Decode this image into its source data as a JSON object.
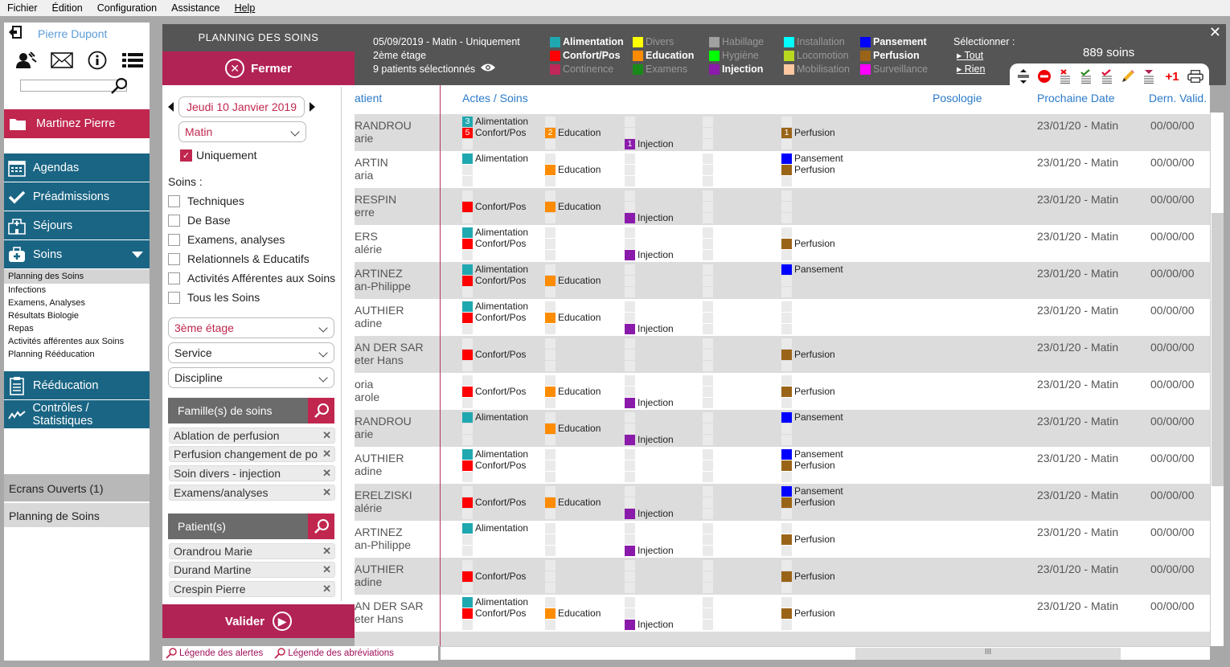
{
  "menubar": [
    "Fichier",
    "Édition",
    "Configuration",
    "Assistance",
    "Help"
  ],
  "user": {
    "name": "Pierre Dupont",
    "search_placeholder": ""
  },
  "patient_button": "Martinez Pierre",
  "nav": {
    "items": [
      "Agendas",
      "Préadmissions",
      "Séjours",
      "Soins"
    ],
    "soins_subitems": [
      "Planning des Soins",
      "Infections",
      "Examens, Analyses",
      "Résultats Biologie",
      "Repas",
      "Activités afférentes aux Soins",
      "Planning  Rééducation"
    ],
    "items2": [
      "Rééducation",
      "Contrôles / Statistiques"
    ],
    "open_screens": "Ecrans Ouverts (1)",
    "open_screen_item": "Planning de Soins"
  },
  "filter": {
    "title": "PLANNING DES SOINS",
    "close": "Fermer",
    "date": "Jeudi 10 Janvier 2019",
    "period": "Matin",
    "only_label": "Uniquement",
    "only_checked": true,
    "soins_label": "Soins :",
    "soins_options": [
      "Techniques",
      "De Base",
      "Examens, analyses",
      "Relationnels & Educatifs",
      "Activités Afférentes aux Soins",
      "Tous les Soins"
    ],
    "floor": "3ème étage",
    "service": "Service",
    "discipline": "Discipline",
    "families_head": "Famille(s) de soins",
    "families": [
      "Ablation de perfusion",
      "Perfusion changement de po",
      "Soin divers - injection",
      "Examens/analyses"
    ],
    "patients_head": "Patient(s)",
    "patients": [
      "Orandrou Marie",
      "Durand Martine",
      "Crespin Pierre"
    ],
    "validate": "Valider"
  },
  "footer_links": [
    "Légende des alertes",
    "Légende des abréviations"
  ],
  "header": {
    "line1": "05/09/2019 - Matin - Uniquement",
    "line2": "2ème étage",
    "line3": "9 patients sélectionnés",
    "select_label": "Sélectionner :",
    "select_all": "Tout",
    "select_none": "Rien",
    "count": "889 soins"
  },
  "legend": [
    [
      {
        "label": "Alimentation",
        "color": "#20a8b0",
        "on": true
      },
      {
        "label": "Confort/Pos",
        "color": "#ff0000",
        "on": true
      },
      {
        "label": "Continence",
        "color": "#c0285a",
        "on": false
      }
    ],
    [
      {
        "label": "Divers",
        "color": "#ffff00",
        "on": false
      },
      {
        "label": "Education",
        "color": "#ff8c00",
        "on": true
      },
      {
        "label": "Examens",
        "color": "#1a8a1a",
        "on": false
      }
    ],
    [
      {
        "label": "Habillage",
        "color": "#a0a0a0",
        "on": false
      },
      {
        "label": "Hygiène",
        "color": "#00ff00",
        "on": false
      },
      {
        "label": "Injection",
        "color": "#8a1aaa",
        "on": true
      }
    ],
    [
      {
        "label": "Installation",
        "color": "#00ffff",
        "on": false
      },
      {
        "label": "Locomotion",
        "color": "#b8d820",
        "on": false
      },
      {
        "label": "Mobilisation",
        "color": "#ffc8a0",
        "on": false
      }
    ],
    [
      {
        "label": "Pansement",
        "color": "#0000ff",
        "on": true
      },
      {
        "label": "Perfusion",
        "color": "#9a6418",
        "on": true
      },
      {
        "label": "Surveillance",
        "color": "#ff00ff",
        "on": false
      }
    ]
  ],
  "toolbar": [
    "expand-collapse",
    "stop",
    "unvalidate",
    "validate-green",
    "validate-red",
    "edit",
    "filter-down",
    "+1",
    "print"
  ],
  "columns": {
    "patient": "atient",
    "acts": "Actes / Soins",
    "posology": "Posologie",
    "next_date": "Prochaine Date",
    "last_valid": "Dern. Valid."
  },
  "rows": [
    {
      "name1": "RANDROU",
      "name2": "arie",
      "alim": "3",
      "conf": "5",
      "edu": "2",
      "inj": "1",
      "pan": null,
      "perf": "1",
      "next": "23/01/20 - Matin",
      "last": "00/00/00"
    },
    {
      "name1": "ARTIN",
      "name2": "aria",
      "alim": "",
      "conf": null,
      "edu": "",
      "inj": null,
      "pan": "",
      "perf": "",
      "next": "23/01/20 - Matin",
      "last": "00/00/00"
    },
    {
      "name1": "RESPIN",
      "name2": "erre",
      "alim": null,
      "conf": "",
      "edu": "",
      "inj": "",
      "pan": null,
      "perf": null,
      "next": "23/01/20 - Matin",
      "last": "00/00/00"
    },
    {
      "name1": "ERS",
      "name2": "alérie",
      "alim": "",
      "conf": "",
      "edu": null,
      "inj": "",
      "pan": null,
      "perf": "",
      "next": "23/01/20 - Matin",
      "last": "00/00/00"
    },
    {
      "name1": "ARTINEZ",
      "name2": "an-Philippe",
      "alim": "",
      "conf": "",
      "edu": "",
      "inj": null,
      "pan": "",
      "perf": null,
      "next": "23/01/20 - Matin",
      "last": "00/00/00"
    },
    {
      "name1": "AUTHIER",
      "name2": "adine",
      "alim": "",
      "conf": "",
      "edu": "",
      "inj": "",
      "pan": null,
      "perf": null,
      "next": "23/01/20 - Matin",
      "last": "00/00/00"
    },
    {
      "name1": "AN DER SAR",
      "name2": "eter Hans",
      "alim": null,
      "conf": "",
      "edu": null,
      "inj": null,
      "pan": null,
      "perf": "",
      "next": "23/01/20 - Matin",
      "last": "00/00/00"
    },
    {
      "name1": "oria",
      "name2": "arole",
      "alim": null,
      "conf": "",
      "edu": "",
      "inj": "",
      "pan": null,
      "perf": "",
      "next": "23/01/20 - Matin",
      "last": "00/00/00"
    },
    {
      "name1": "RANDROU",
      "name2": "arie",
      "alim": "",
      "conf": null,
      "edu": "",
      "inj": "",
      "pan": "",
      "perf": null,
      "next": "23/01/20 - Matin",
      "last": "00/00/00"
    },
    {
      "name1": "AUTHIER",
      "name2": "adine",
      "alim": "",
      "conf": "",
      "edu": null,
      "inj": null,
      "pan": "",
      "perf": "",
      "next": "23/01/20 - Matin",
      "last": "00/00/00"
    },
    {
      "name1": "ERELZISKI",
      "name2": "alérie",
      "alim": null,
      "conf": "",
      "edu": "",
      "inj": "",
      "pan": "",
      "perf": "",
      "next": "23/01/20 - Matin",
      "last": "00/00/00"
    },
    {
      "name1": "ARTINEZ",
      "name2": "an-Philippe",
      "alim": "",
      "conf": null,
      "edu": null,
      "inj": "",
      "pan": null,
      "perf": "",
      "next": "23/01/20 - Matin",
      "last": "00/00/00"
    },
    {
      "name1": "AUTHIER",
      "name2": "adine",
      "alim": null,
      "conf": "",
      "edu": null,
      "inj": null,
      "pan": null,
      "perf": "",
      "next": "23/01/20 - Matin",
      "last": "00/00/00"
    },
    {
      "name1": "AN DER SAR",
      "name2": "eter Hans",
      "alim": "",
      "conf": "",
      "edu": "",
      "inj": "",
      "pan": null,
      "perf": "",
      "next": "23/01/20 - Matin",
      "last": "00/00/00"
    }
  ],
  "care_labels": {
    "alim": "Alimentation",
    "conf": "Confort/Pos",
    "edu": "Education",
    "inj": "Injection",
    "pan": "Pansement",
    "perf": "Perfusion"
  },
  "care_colors": {
    "alim": "#20a8b0",
    "conf": "#ff0000",
    "edu": "#ff8c00",
    "inj": "#8a1aaa",
    "pan": "#0000ff",
    "perf": "#9a6418"
  }
}
